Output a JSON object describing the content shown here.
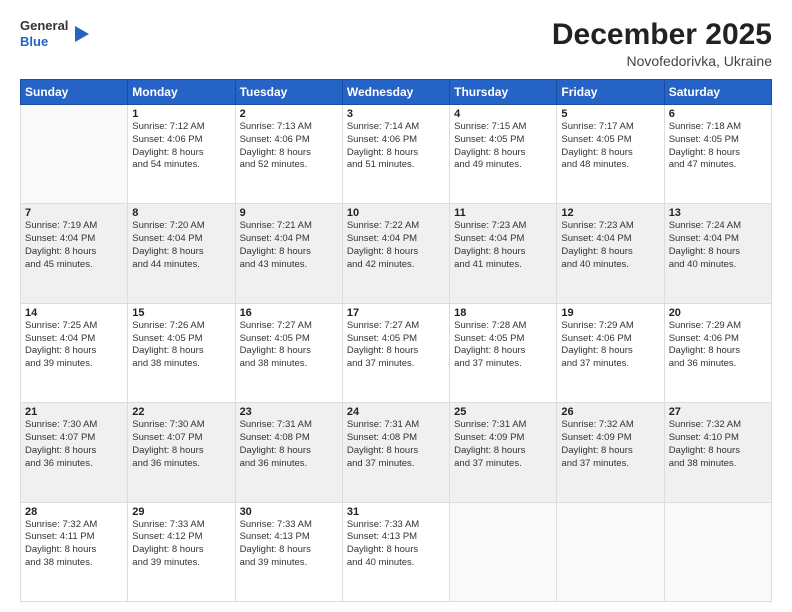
{
  "logo": {
    "general": "General",
    "blue": "Blue"
  },
  "header": {
    "month": "December 2025",
    "location": "Novofedorivka, Ukraine"
  },
  "days_of_week": [
    "Sunday",
    "Monday",
    "Tuesday",
    "Wednesday",
    "Thursday",
    "Friday",
    "Saturday"
  ],
  "weeks": [
    [
      {
        "day": "",
        "info": ""
      },
      {
        "day": "1",
        "info": "Sunrise: 7:12 AM\nSunset: 4:06 PM\nDaylight: 8 hours\nand 54 minutes."
      },
      {
        "day": "2",
        "info": "Sunrise: 7:13 AM\nSunset: 4:06 PM\nDaylight: 8 hours\nand 52 minutes."
      },
      {
        "day": "3",
        "info": "Sunrise: 7:14 AM\nSunset: 4:06 PM\nDaylight: 8 hours\nand 51 minutes."
      },
      {
        "day": "4",
        "info": "Sunrise: 7:15 AM\nSunset: 4:05 PM\nDaylight: 8 hours\nand 49 minutes."
      },
      {
        "day": "5",
        "info": "Sunrise: 7:17 AM\nSunset: 4:05 PM\nDaylight: 8 hours\nand 48 minutes."
      },
      {
        "day": "6",
        "info": "Sunrise: 7:18 AM\nSunset: 4:05 PM\nDaylight: 8 hours\nand 47 minutes."
      }
    ],
    [
      {
        "day": "7",
        "info": "Sunrise: 7:19 AM\nSunset: 4:04 PM\nDaylight: 8 hours\nand 45 minutes."
      },
      {
        "day": "8",
        "info": "Sunrise: 7:20 AM\nSunset: 4:04 PM\nDaylight: 8 hours\nand 44 minutes."
      },
      {
        "day": "9",
        "info": "Sunrise: 7:21 AM\nSunset: 4:04 PM\nDaylight: 8 hours\nand 43 minutes."
      },
      {
        "day": "10",
        "info": "Sunrise: 7:22 AM\nSunset: 4:04 PM\nDaylight: 8 hours\nand 42 minutes."
      },
      {
        "day": "11",
        "info": "Sunrise: 7:23 AM\nSunset: 4:04 PM\nDaylight: 8 hours\nand 41 minutes."
      },
      {
        "day": "12",
        "info": "Sunrise: 7:23 AM\nSunset: 4:04 PM\nDaylight: 8 hours\nand 40 minutes."
      },
      {
        "day": "13",
        "info": "Sunrise: 7:24 AM\nSunset: 4:04 PM\nDaylight: 8 hours\nand 40 minutes."
      }
    ],
    [
      {
        "day": "14",
        "info": "Sunrise: 7:25 AM\nSunset: 4:04 PM\nDaylight: 8 hours\nand 39 minutes."
      },
      {
        "day": "15",
        "info": "Sunrise: 7:26 AM\nSunset: 4:05 PM\nDaylight: 8 hours\nand 38 minutes."
      },
      {
        "day": "16",
        "info": "Sunrise: 7:27 AM\nSunset: 4:05 PM\nDaylight: 8 hours\nand 38 minutes."
      },
      {
        "day": "17",
        "info": "Sunrise: 7:27 AM\nSunset: 4:05 PM\nDaylight: 8 hours\nand 37 minutes."
      },
      {
        "day": "18",
        "info": "Sunrise: 7:28 AM\nSunset: 4:05 PM\nDaylight: 8 hours\nand 37 minutes."
      },
      {
        "day": "19",
        "info": "Sunrise: 7:29 AM\nSunset: 4:06 PM\nDaylight: 8 hours\nand 37 minutes."
      },
      {
        "day": "20",
        "info": "Sunrise: 7:29 AM\nSunset: 4:06 PM\nDaylight: 8 hours\nand 36 minutes."
      }
    ],
    [
      {
        "day": "21",
        "info": "Sunrise: 7:30 AM\nSunset: 4:07 PM\nDaylight: 8 hours\nand 36 minutes."
      },
      {
        "day": "22",
        "info": "Sunrise: 7:30 AM\nSunset: 4:07 PM\nDaylight: 8 hours\nand 36 minutes."
      },
      {
        "day": "23",
        "info": "Sunrise: 7:31 AM\nSunset: 4:08 PM\nDaylight: 8 hours\nand 36 minutes."
      },
      {
        "day": "24",
        "info": "Sunrise: 7:31 AM\nSunset: 4:08 PM\nDaylight: 8 hours\nand 37 minutes."
      },
      {
        "day": "25",
        "info": "Sunrise: 7:31 AM\nSunset: 4:09 PM\nDaylight: 8 hours\nand 37 minutes."
      },
      {
        "day": "26",
        "info": "Sunrise: 7:32 AM\nSunset: 4:09 PM\nDaylight: 8 hours\nand 37 minutes."
      },
      {
        "day": "27",
        "info": "Sunrise: 7:32 AM\nSunset: 4:10 PM\nDaylight: 8 hours\nand 38 minutes."
      }
    ],
    [
      {
        "day": "28",
        "info": "Sunrise: 7:32 AM\nSunset: 4:11 PM\nDaylight: 8 hours\nand 38 minutes."
      },
      {
        "day": "29",
        "info": "Sunrise: 7:33 AM\nSunset: 4:12 PM\nDaylight: 8 hours\nand 39 minutes."
      },
      {
        "day": "30",
        "info": "Sunrise: 7:33 AM\nSunset: 4:13 PM\nDaylight: 8 hours\nand 39 minutes."
      },
      {
        "day": "31",
        "info": "Sunrise: 7:33 AM\nSunset: 4:13 PM\nDaylight: 8 hours\nand 40 minutes."
      },
      {
        "day": "",
        "info": ""
      },
      {
        "day": "",
        "info": ""
      },
      {
        "day": "",
        "info": ""
      }
    ]
  ]
}
